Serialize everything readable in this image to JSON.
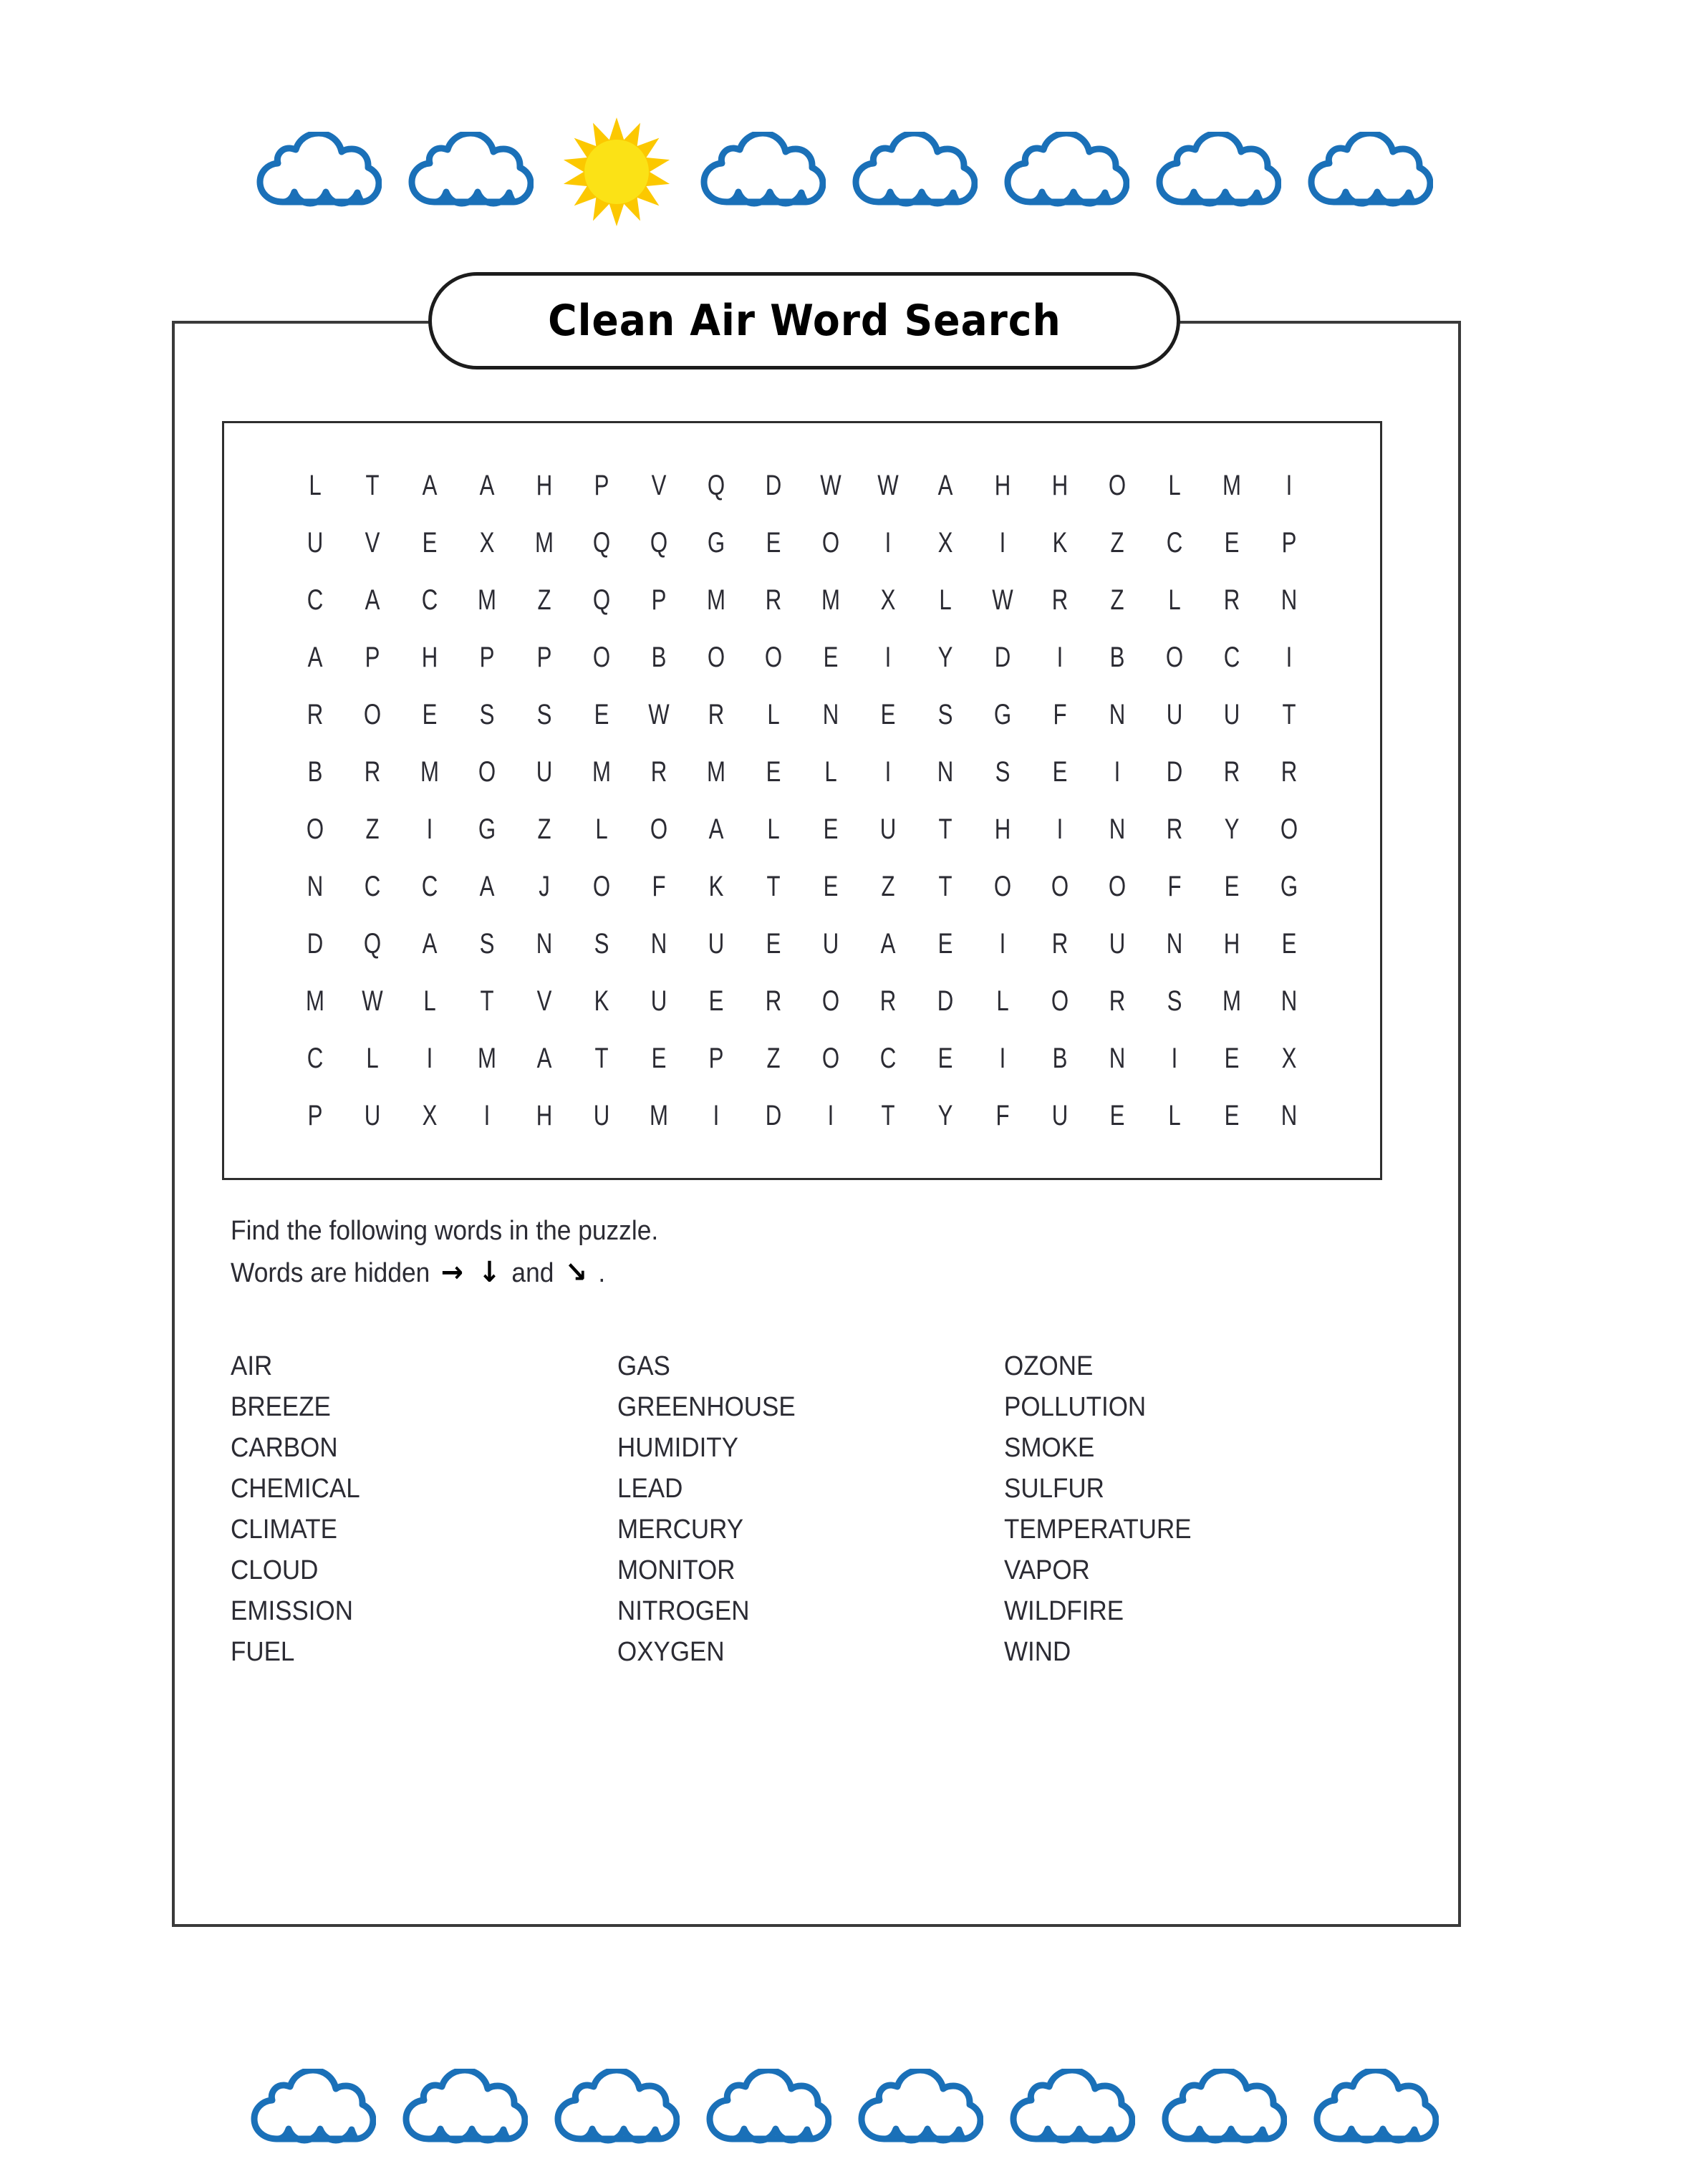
{
  "page": {
    "title": "Clean Air Word Search"
  },
  "decor": {
    "top": {
      "items": [
        "cloud-icon",
        "cloud-icon",
        "sun-icon",
        "cloud-icon",
        "cloud-icon",
        "cloud-icon",
        "cloud-icon",
        "cloud-icon"
      ],
      "cloud_color": "#1A70B8",
      "cloud_fill": "#FFFFFF",
      "sun_core_color": "#FBE216",
      "sun_ray_color": "#FCC800"
    },
    "bottom": {
      "items": [
        "cloud-icon",
        "cloud-icon",
        "cloud-icon",
        "cloud-icon",
        "cloud-icon",
        "cloud-icon",
        "cloud-icon",
        "cloud-icon"
      ],
      "cloud_color": "#1A70B8",
      "cloud_fill": "#FFFFFF"
    }
  },
  "puzzle": {
    "rows": 12,
    "cols": 18,
    "grid": [
      [
        "L",
        "T",
        "A",
        "A",
        "H",
        "P",
        "V",
        "Q",
        "D",
        "W",
        "W",
        "A",
        "H",
        "H",
        "O",
        "L",
        "M",
        "I"
      ],
      [
        "U",
        "V",
        "E",
        "X",
        "M",
        "Q",
        "Q",
        "G",
        "E",
        "O",
        "I",
        "X",
        "I",
        "K",
        "Z",
        "C",
        "E",
        "P"
      ],
      [
        "C",
        "A",
        "C",
        "M",
        "Z",
        "Q",
        "P",
        "M",
        "R",
        "M",
        "X",
        "L",
        "W",
        "R",
        "Z",
        "L",
        "R",
        "N"
      ],
      [
        "A",
        "P",
        "H",
        "P",
        "P",
        "O",
        "B",
        "O",
        "O",
        "E",
        "I",
        "Y",
        "D",
        "I",
        "B",
        "O",
        "C",
        "I"
      ],
      [
        "R",
        "O",
        "E",
        "S",
        "S",
        "E",
        "W",
        "R",
        "L",
        "N",
        "E",
        "S",
        "G",
        "F",
        "N",
        "U",
        "U",
        "T"
      ],
      [
        "B",
        "R",
        "M",
        "O",
        "U",
        "M",
        "R",
        "M",
        "E",
        "L",
        "I",
        "N",
        "S",
        "E",
        "I",
        "D",
        "R",
        "R"
      ],
      [
        "O",
        "Z",
        "I",
        "G",
        "Z",
        "L",
        "O",
        "A",
        "L",
        "E",
        "U",
        "T",
        "H",
        "I",
        "N",
        "R",
        "Y",
        "O"
      ],
      [
        "N",
        "C",
        "C",
        "A",
        "J",
        "O",
        "F",
        "K",
        "T",
        "E",
        "Z",
        "T",
        "O",
        "O",
        "O",
        "F",
        "E",
        "G"
      ],
      [
        "D",
        "Q",
        "A",
        "S",
        "N",
        "S",
        "N",
        "U",
        "E",
        "U",
        "A",
        "E",
        "I",
        "R",
        "U",
        "N",
        "H",
        "E"
      ],
      [
        "M",
        "W",
        "L",
        "T",
        "V",
        "K",
        "U",
        "E",
        "R",
        "O",
        "R",
        "D",
        "L",
        "O",
        "R",
        "S",
        "M",
        "N"
      ],
      [
        "C",
        "L",
        "I",
        "M",
        "A",
        "T",
        "E",
        "P",
        "Z",
        "O",
        "C",
        "E",
        "I",
        "B",
        "N",
        "I",
        "E",
        "X"
      ],
      [
        "P",
        "U",
        "X",
        "I",
        "H",
        "U",
        "M",
        "I",
        "D",
        "I",
        "T",
        "Y",
        "F",
        "U",
        "E",
        "L",
        "E",
        "N"
      ]
    ]
  },
  "instructions": {
    "line1": "Find the following words in the puzzle.",
    "line2_prefix": "Words are hidden",
    "arrow_right": "→",
    "arrow_down": "↓",
    "conjunction": "and",
    "arrow_diagonal": "↘",
    "line2_suffix": "."
  },
  "words": {
    "column1": [
      "AIR",
      "BREEZE",
      "CARBON",
      "CHEMICAL",
      "CLIMATE",
      "CLOUD",
      "EMISSION",
      "FUEL"
    ],
    "column2": [
      "GAS",
      "GREENHOUSE",
      "HUMIDITY",
      "LEAD",
      "MERCURY",
      "MONITOR",
      "NITROGEN",
      "OXYGEN"
    ],
    "column3": [
      "OZONE",
      "POLLUTION",
      "SMOKE",
      "SULFUR",
      "TEMPERATURE",
      "VAPOR",
      "WILDFIRE",
      "WIND"
    ]
  }
}
